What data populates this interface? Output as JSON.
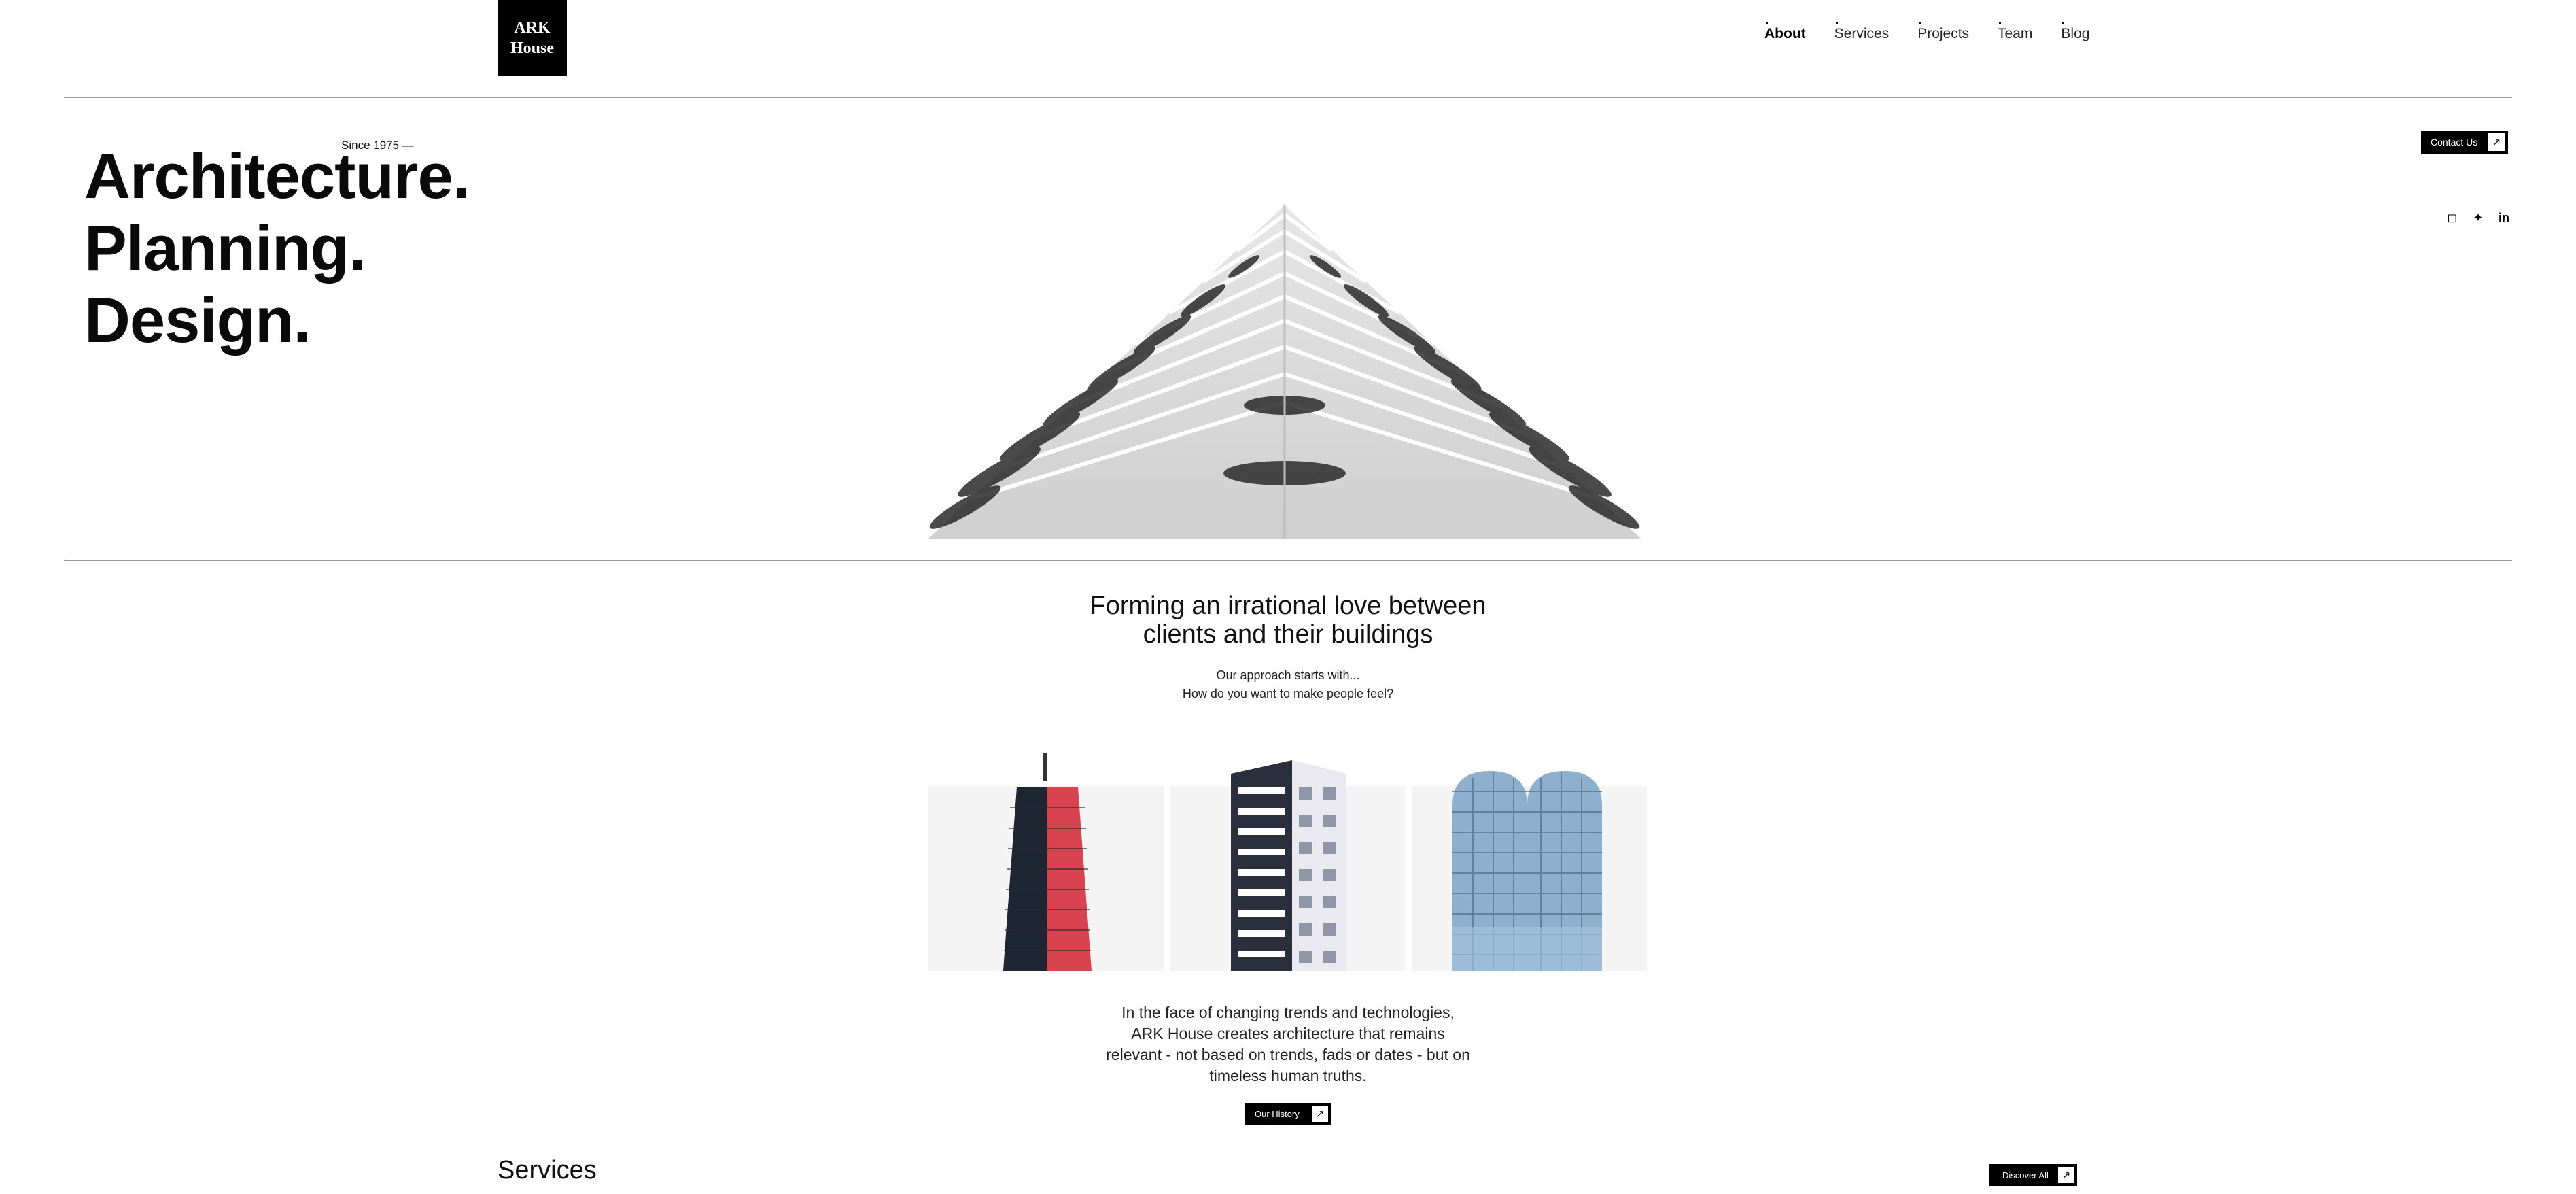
{
  "logo": {
    "line1": "ARK",
    "line2": "House"
  },
  "nav": {
    "items": [
      {
        "label": "About",
        "active": true
      },
      {
        "label": "Services",
        "active": false
      },
      {
        "label": "Projects",
        "active": false
      },
      {
        "label": "Team",
        "active": false
      },
      {
        "label": "Blog",
        "active": false
      }
    ]
  },
  "hero": {
    "since": "Since 1975 —",
    "line1": "Architecture.",
    "line2": "Planning.",
    "line3": "Design.",
    "contact_label": "Contact Us",
    "arrow_icon": "arrow-up-right-icon"
  },
  "social": [
    {
      "icon": "instagram-icon",
      "glyph": "◻"
    },
    {
      "icon": "twitter-icon",
      "glyph": "✦"
    },
    {
      "icon": "linkedin-icon",
      "glyph": "in"
    }
  ],
  "intro": {
    "heading_line1": "Forming an irrational love between",
    "heading_line2": "clients and their buildings",
    "sub_line1": "Our approach starts with...",
    "sub_line2": "How do you want to make people feel?"
  },
  "about": {
    "line1": "In the face of changing trends and technologies,",
    "line2": "ARK House creates architecture that remains",
    "line3": "relevant - not based on trends, fads or dates - but on",
    "line4": "timeless human truths.",
    "history_label": "Our History"
  },
  "services": {
    "title": "Services",
    "discover_label": "Discover All"
  },
  "colors": {
    "accent": "#000000",
    "background": "#ffffff",
    "card_bg": "#f4f4f4",
    "tower_red": "#d9434f"
  }
}
